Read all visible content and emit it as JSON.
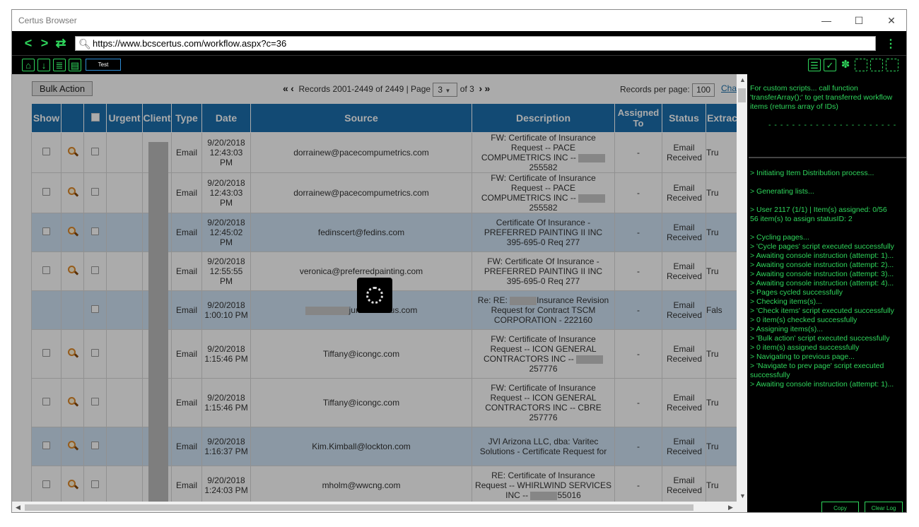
{
  "window": {
    "title": "Certus Browser",
    "minimize": "—",
    "maximize": "☐",
    "close": "✕"
  },
  "nav": {
    "url": "https://www.bcscertus.com/workflow.aspx?c=36",
    "back": "<",
    "forward": ">",
    "refresh": "⇄",
    "menu": "⋮"
  },
  "toolbar": {
    "test_label": "Test"
  },
  "controls": {
    "bulk_action": "Bulk Action",
    "first": "«",
    "prev": "‹",
    "records": "Records 2001-2449 of 2449 | Page",
    "page": "3",
    "of_pages": "of 3",
    "next": "›",
    "last": "»",
    "per_page_label": "Records per page:",
    "per_page": "100",
    "change_link": "Cha"
  },
  "table": {
    "headers": [
      "Show",
      "",
      "",
      "Urgent",
      "Client",
      "Type",
      "Date",
      "Source",
      "Description",
      "Assigned To",
      "Status",
      "Extrac"
    ],
    "rows": [
      {
        "type": "Email",
        "date": "9/20/2018 12:43:03 PM",
        "source": "dorrainew@pacecompumetrics.com",
        "desc_pre": "FW: Certificate of Insurance Request -- PACE COMPUMETRICS INC -- ",
        "desc_post": "255582",
        "assigned": "-",
        "status": "Email Received",
        "extra": "Tru",
        "hl": false,
        "show": true
      },
      {
        "type": "Email",
        "date": "9/20/2018 12:43:03 PM",
        "source": "dorrainew@pacecompumetrics.com",
        "desc_pre": "FW: Certificate of Insurance Request -- PACE COMPUMETRICS INC -- ",
        "desc_post": "255582",
        "assigned": "-",
        "status": "Email Received",
        "extra": "Tru",
        "hl": false,
        "show": true
      },
      {
        "type": "Email",
        "date": "9/20/2018 12:45:02 PM",
        "source": "fedinscert@fedins.com",
        "desc_pre": "Certificate Of Insurance - PREFERRED PAINTING II INC 395-695-0 Req 277",
        "desc_post": "",
        "assigned": "-",
        "status": "Email Received",
        "extra": "Tru",
        "hl": true,
        "show": true
      },
      {
        "type": "Email",
        "date": "9/20/2018 12:55:55 PM",
        "source": "veronica@preferredpainting.com",
        "desc_pre": "FW: Certificate Of Insurance - PREFERRED PAINTING II INC 395-695-0 Req 277",
        "desc_post": "",
        "assigned": "-",
        "status": "Email Received",
        "extra": "Tru",
        "hl": false,
        "show": true
      },
      {
        "type": "Email",
        "date": "9/20/2018 1:00:10 PM",
        "source": "jun.bcscertus.com",
        "desc_pre": "Re: RE: ",
        "desc_post": "Insurance Revision Request for Contract TSCM CORPORATION - 222160",
        "assigned": "-",
        "status": "Email Received",
        "extra": "Fals",
        "hl": true,
        "show": false
      },
      {
        "type": "Email",
        "date": "9/20/2018 1:15:46 PM",
        "source": "Tiffany@icongc.com",
        "desc_pre": "FW: Certificate of Insurance Request -- ICON GENERAL CONTRACTORS INC -- ",
        "desc_post": "257776",
        "assigned": "-",
        "status": "Email Received",
        "extra": "Tru",
        "hl": false,
        "show": true
      },
      {
        "type": "Email",
        "date": "9/20/2018 1:15:46 PM",
        "source": "Tiffany@icongc.com",
        "desc_pre": "FW: Certificate of Insurance Request -- ICON GENERAL CONTRACTORS INC -- CBRE 257776",
        "desc_post": "",
        "assigned": "-",
        "status": "Email Received",
        "extra": "Tru",
        "hl": false,
        "show": true
      },
      {
        "type": "Email",
        "date": "9/20/2018 1:16:37 PM",
        "source": "Kim.Kimball@lockton.com",
        "desc_pre": "JVI Arizona LLC, dba: Varitec Solutions - Certificate Request for",
        "desc_post": "",
        "assigned": "-",
        "status": "Email Received",
        "extra": "Tru",
        "hl": true,
        "show": true
      },
      {
        "type": "Email",
        "date": "9/20/2018 1:24:03 PM",
        "source": "mholm@wwcng.com",
        "desc_pre": "RE: Certificate of Insurance Request -- WHIRLWIND SERVICES INC -- ",
        "desc_post": "55016",
        "assigned": "-",
        "status": "Email Received",
        "extra": "Tru",
        "hl": false,
        "show": true
      }
    ]
  },
  "console": {
    "help": "For custom scripts... call function 'transferArray();' to get transferred workflow items (returns array of IDs)",
    "dashes": "- - - - - - - - - - - - - - - - - - - - - -",
    "log": [
      "> Initiating Item Distribution process...",
      "",
      "> Generating lists...",
      "",
      "> User 2117 (1/1) | Item(s) assigned: 0/56",
      "56 item(s) to assign statusID: 2",
      "",
      "> Cycling pages...",
      "> 'Cycle pages' script executed successfully",
      "> Awaiting console instruction (attempt: 1)...",
      "> Awaiting console instruction (attempt: 2)...",
      "> Awaiting console instruction (attempt: 3)...",
      "> Awaiting console instruction (attempt: 4)...",
      "> Pages cycled successfully",
      "> Checking items(s)...",
      "> 'Check items' script executed successfully",
      "> 0 item(s) checked successfully",
      "> Assigning items(s)...",
      "> 'Bulk action' script executed successfully",
      "> 0 item(s) assigned successfully",
      "> Navigating to previous page...",
      "> 'Navigate to prev page' script executed successfully",
      "> Awaiting console instruction (attempt: 1)..."
    ],
    "copy": "Copy",
    "clear": "Clear Log"
  }
}
